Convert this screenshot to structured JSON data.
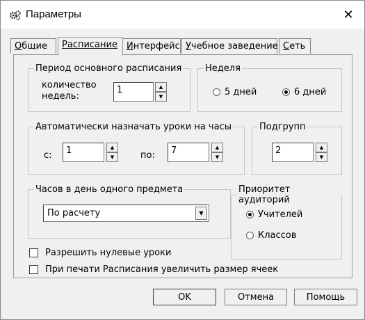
{
  "window": {
    "title": "Параметры",
    "close_glyph": "✕",
    "icon": "gear-icon"
  },
  "tabs": [
    {
      "label": "Общие",
      "hot": "О",
      "rest": "бщие"
    },
    {
      "label": "Расписание",
      "hot": "Р",
      "rest": "асписание"
    },
    {
      "label": "Интерфейс",
      "hot": "И",
      "rest": "нтерфейс"
    },
    {
      "label": "Учебное заведение",
      "hot": "У",
      "rest": "чебное заведение"
    },
    {
      "label": "Сеть",
      "hot": "С",
      "rest": "еть"
    }
  ],
  "period": {
    "legend": "Период основного расписания",
    "label": "количество\nнедель:",
    "value": "1"
  },
  "week": {
    "legend": "Неделя",
    "opt1": "5 дней",
    "opt2": "6 дней",
    "selected": "6 дней"
  },
  "auto": {
    "legend": "Автоматически назначать уроки на часы",
    "from_label": "с:",
    "from_value": "1",
    "to_label": "по:",
    "to_value": "7"
  },
  "subgroups": {
    "legend": "Подгрупп",
    "value": "2"
  },
  "hours": {
    "legend": "Часов в день одного предмета",
    "value": "По расчету"
  },
  "priority": {
    "legend": "Приоритет аудиторий",
    "opt1": "Учителей",
    "opt2": "Классов",
    "selected": "Учителей"
  },
  "checks": {
    "zero": "Разрешить нулевые уроки",
    "print": "При печати Расписания увеличить размер ячеек"
  },
  "buttons": {
    "ok": "OK",
    "cancel": "Отмена",
    "help": "Помощь"
  }
}
